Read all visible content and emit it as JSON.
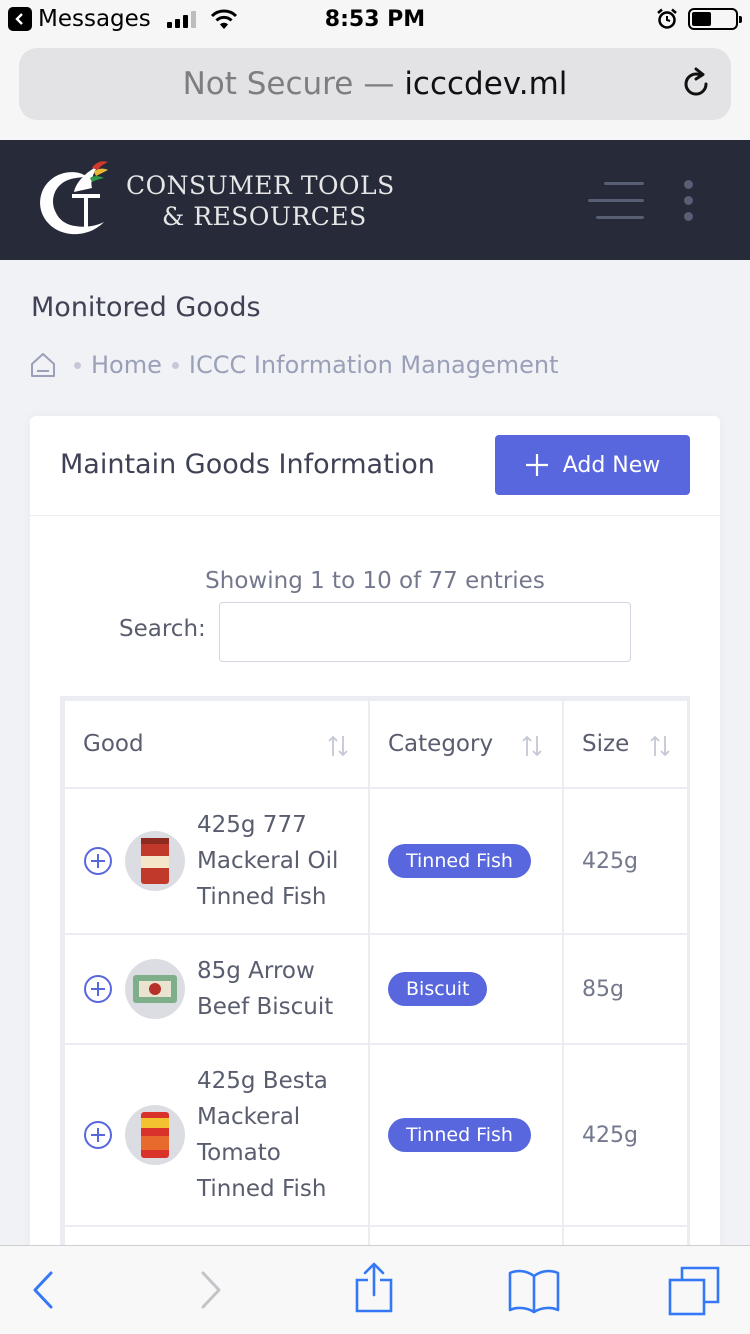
{
  "status_bar": {
    "back_app": "Messages",
    "time": "8:53 PM"
  },
  "browser": {
    "url_security": "Not Secure",
    "url_separator": "—",
    "url_domain": "icccdev.ml"
  },
  "header": {
    "logo_line1": "CONSUMER TOOLS",
    "logo_line2": "& RESOURCES"
  },
  "page": {
    "title": "Monitored Goods",
    "breadcrumb": [
      "Home",
      "ICCC Information Management"
    ]
  },
  "card": {
    "title": "Maintain Goods Information",
    "add_label": "Add New",
    "info": "Showing 1 to 10 of 77 entries",
    "search_label": "Search:",
    "search_value": ""
  },
  "table": {
    "columns": [
      "Good",
      "Category",
      "Size"
    ],
    "rows": [
      {
        "name_lines": [
          "425g 777",
          "Mackeral Oil",
          "Tinned Fish"
        ],
        "category": "Tinned Fish",
        "size": "425g"
      },
      {
        "name_lines": [
          "85g Arrow",
          "Beef Biscuit"
        ],
        "category": "Biscuit",
        "size": "85g"
      },
      {
        "name_lines": [
          "425g Besta",
          "Mackeral",
          "Tomato",
          "Tinned Fish"
        ],
        "category": "Tinned Fish",
        "size": "425g"
      }
    ]
  },
  "colors": {
    "accent": "#5867dd",
    "header_bg": "#262a39",
    "ios_blue": "#3478f6"
  }
}
